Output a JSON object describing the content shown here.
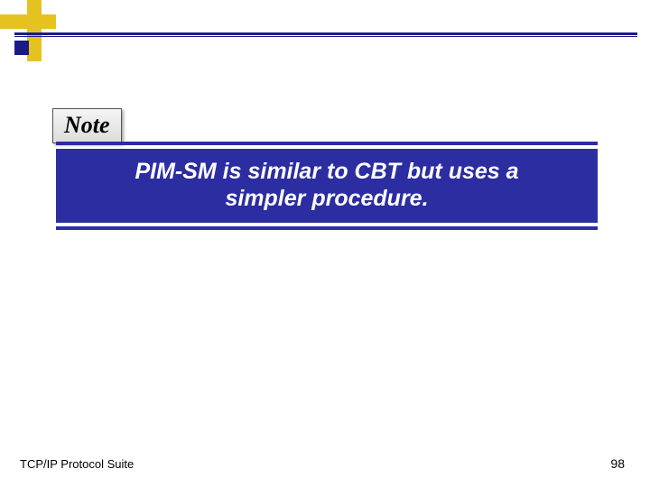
{
  "note": {
    "label": "Note"
  },
  "statement": {
    "line1": "PIM-SM is similar to CBT but uses a",
    "line2": "simpler procedure."
  },
  "footer": {
    "left": "TCP/IP Protocol Suite",
    "right": "98"
  },
  "colors": {
    "accent_navy": "#2b2da1",
    "accent_gold": "#e6c221"
  }
}
